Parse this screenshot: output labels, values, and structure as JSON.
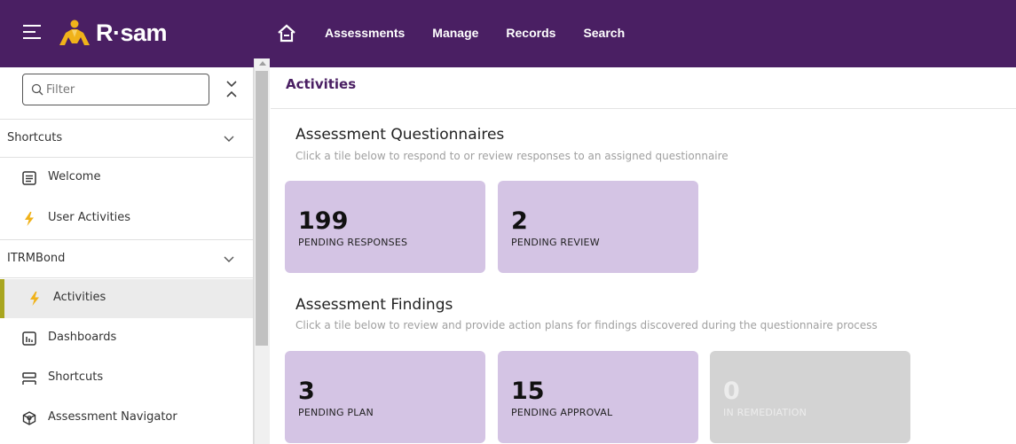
{
  "brand": {
    "name": "R·sam",
    "color": "#4a1f63",
    "logo_color": "#f0b21a"
  },
  "nav": {
    "home_icon": "home-icon",
    "items": [
      {
        "label": "Assessments"
      },
      {
        "label": "Manage"
      },
      {
        "label": "Records"
      },
      {
        "label": "Search"
      }
    ]
  },
  "sidebar": {
    "filter": {
      "placeholder": "Filter"
    },
    "sections": [
      {
        "label": "Shortcuts",
        "items": [
          {
            "label": "Welcome",
            "icon": "document-list-icon"
          },
          {
            "label": "User Activities",
            "icon": "lightning-icon"
          }
        ]
      },
      {
        "label": "ITRMBond",
        "items": [
          {
            "label": "Activities",
            "icon": "lightning-icon",
            "active": true
          },
          {
            "label": "Dashboards",
            "icon": "dashboard-icon"
          },
          {
            "label": "Shortcuts",
            "icon": "shortcuts-icon"
          },
          {
            "label": "Assessment Navigator",
            "icon": "navigator-icon"
          }
        ]
      }
    ]
  },
  "main": {
    "page_title": "Activities",
    "questionnaires": {
      "title": "Assessment Questionnaires",
      "subtitle": "Click a tile below to respond to or review responses to an assigned questionnaire",
      "tiles": [
        {
          "count": "199",
          "label": "PENDING RESPONSES"
        },
        {
          "count": "2",
          "label": "PENDING REVIEW"
        }
      ]
    },
    "findings": {
      "title": "Assessment Findings",
      "subtitle": "Click a tile below to review and provide action plans for findings discovered during the questionnaire process",
      "tiles": [
        {
          "count": "3",
          "label": "PENDING PLAN"
        },
        {
          "count": "15",
          "label": "PENDING APPROVAL"
        },
        {
          "count": "0",
          "label": "IN REMEDIATION",
          "disabled": true
        }
      ]
    }
  },
  "colors": {
    "tile": "#d4c4e4",
    "tile_disabled": "#d3d3d3",
    "active_marker": "#a9a620",
    "lightning": "#f0b21a"
  }
}
